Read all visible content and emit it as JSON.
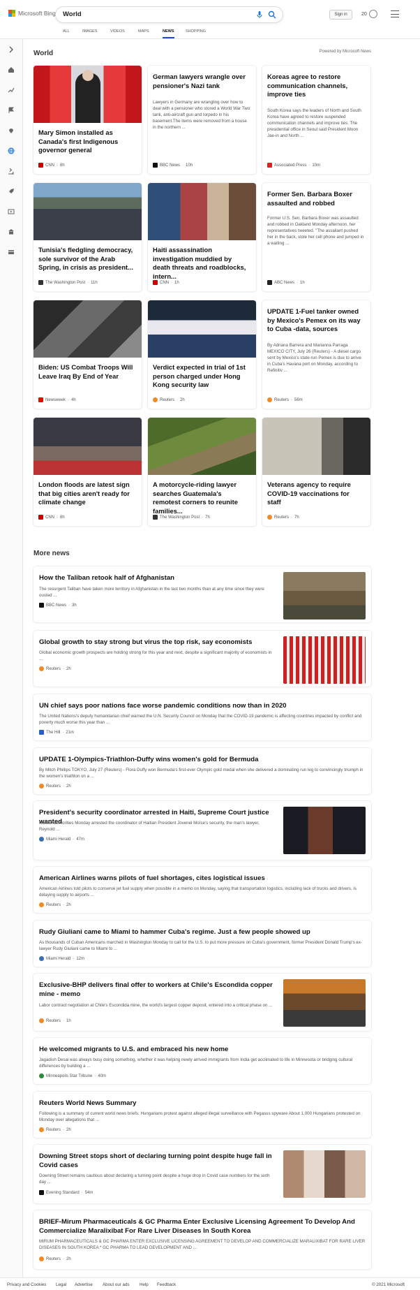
{
  "header": {
    "logo_text": "Microsoft Bing",
    "search_query": "World",
    "sign_in": "Sign in",
    "rewards": "20"
  },
  "tabs": [
    "ALL",
    "IMAGES",
    "VIDEOS",
    "MAPS",
    "NEWS",
    "SHOPPING"
  ],
  "section": {
    "title": "World",
    "powered": "Powered by Microsoft News"
  },
  "cards": [
    {
      "title": "Mary Simon installed as Canada's first Indigenous governor general",
      "snippet": "",
      "source": "CNN",
      "time": "8h",
      "src_color": "#c00"
    },
    {
      "title": "German lawyers wrangle over pensioner's Nazi tank",
      "snippet": "Lawyers in Germany are wrangling over how to deal with a pensioner who stored a World War Two tank, anti-aircraft gun and torpedo in his basement.The items were removed from a house in the northern ...",
      "source": "BBC News",
      "time": "10h",
      "src_color": "#111"
    },
    {
      "title": "Koreas agree to restore communication channels, improve ties",
      "snippet": "South Korea says the leaders of North and South Korea have agreed to restore suspended communication channels and improve ties. The presidential office in Seoul said President Moon Jae-in and North ...",
      "source": "Associated Press",
      "time": "10m",
      "src_color": "#d22"
    },
    {
      "title": "Tunisia's fledgling democracy, sole survivor of the Arab Spring, in crisis as president...",
      "snippet": "",
      "source": "The Washington Post",
      "time": "11h",
      "src_color": "#333"
    },
    {
      "title": "Haiti assassination investigation muddied by death threats and roadblocks, intern...",
      "snippet": "",
      "source": "CNN",
      "time": "1h",
      "src_color": "#c00"
    },
    {
      "title": "Former Sen. Barbara Boxer assaulted and robbed",
      "snippet": "Former U.S. Sen. Barbara Boxer was assaulted and robbed in Oakland Monday afternoon, her representatives tweeted. \"The assailant pushed her in the back, stole her cell phone and jumped in a waiting ...",
      "source": "ABC News",
      "time": "1h",
      "src_color": "#222"
    },
    {
      "title": "Biden: US Combat Troops Will Leave Iraq By End of Year",
      "snippet": "",
      "source": "Newsweek",
      "time": "4h",
      "src_color": "#d10"
    },
    {
      "title": "Verdict expected in trial of 1st person charged under Hong Kong security law",
      "snippet": "",
      "source": "Reuters",
      "time": "2h",
      "src_color": "#f08a24"
    },
    {
      "title": "UPDATE 1-Fuel tanker owned by Mexico's Pemex on its way to Cuba -data, sources",
      "snippet": "By Adriana Barrera and Marianna Parraga MEXICO CITY, July 26 (Reuters) - A diesel cargo sent by Mexico's state-run Pemex is due to arrive in Cuba's Havana port on Monday, according to Refinitiv ...",
      "source": "Reuters",
      "time": "56m",
      "src_color": "#f08a24"
    },
    {
      "title": "London floods are latest sign that big cities aren't ready for climate change",
      "snippet": "",
      "source": "CNN",
      "time": "8h",
      "src_color": "#c00"
    },
    {
      "title": "A motorcycle-riding lawyer searches Guatemala's remotest corners to reunite families...",
      "snippet": "",
      "source": "The Washington Post",
      "time": "7h",
      "src_color": "#333"
    },
    {
      "title": "Veterans agency to require COVID-19 vaccinations for staff",
      "snippet": "",
      "source": "Reuters",
      "time": "7h",
      "src_color": "#f08a24"
    }
  ],
  "more_title": "More news",
  "more": [
    {
      "title": "How the Taliban retook half of Afghanistan",
      "snippet": "The resurgent Taliban have taken more territory in Afghanistan in the last two months than at any time since they were ousted ...",
      "source": "BBC News",
      "time": "3h",
      "src_color": "#111"
    },
    {
      "title": "Global growth to stay strong but virus the top risk, say economists",
      "snippet": "Global economic growth prospects are holding strong for this year and next, despite a significant majority of economists in ...",
      "source": "Reuters",
      "time": "2h",
      "src_color": "#f08a24"
    },
    {
      "title": "UN chief says poor nations face worse pandemic conditions now than in 2020",
      "snippet": "The United Nations's deputy humanitarian chief warned the U.N. Security Council on Monday that the COVID-19 pandemic is affecting countries impacted by conflict and poverty much worse this year than ...",
      "source": "The Hill",
      "time": "21m",
      "src_color": "#2a5bd7"
    },
    {
      "title": "UPDATE 1-Olympics-Triathlon-Duffy wins women's gold for Bermuda",
      "snippet": "By Mitch Phillips TOKYO, July 27 (Reuters) - Flora Duffy won Bermuda's first-ever Olympic gold medal when she delivered a dominating run leg to convincingly triumph in the women's triathlon on a ...",
      "source": "Reuters",
      "time": "2h",
      "src_color": "#f08a24"
    },
    {
      "title": "President's security coordinator arrested in Haiti, Supreme Court justice wanted",
      "snippet": "Haitian authorities Monday arrested the coordinator of Haitian President Jovenel Moïse's security, the man's lawyer, Reynold ...",
      "source": "Miami Herald",
      "time": "47m",
      "src_color": "#3a6fb0"
    },
    {
      "title": "American Airlines warns pilots of fuel shortages, cites logistical issues",
      "snippet": "American Airlines told pilots to conserve jet fuel supply when possible in a memo on Monday, saying that transportation logistics, including lack of trucks and drivers, is delaying supply to airports ...",
      "source": "Reuters",
      "time": "2h",
      "src_color": "#f08a24"
    },
    {
      "title": "Rudy Giuliani came to Miami to hammer Cuba's regime. Just a few people showed up",
      "snippet": "As thousands of Cuban Americans marched in Washington Monday to call for the U.S. to put more pressure on Cuba's government, former President Donald Trump's ex-lawyer Rudy Giuliani came to Miami to ...",
      "source": "Miami Herald",
      "time": "12m",
      "src_color": "#3a6fb0"
    },
    {
      "title": "Exclusive-BHP delivers final offer to workers at Chile's Escondida copper mine - memo",
      "snippet": "Labor contract negotiation at Chile's Escondida mine, the world's largest copper deposit, entered into a critical phase on ...",
      "source": "Reuters",
      "time": "1h",
      "src_color": "#f08a24"
    },
    {
      "title": "He welcomed migrants to U.S. and embraced his new home",
      "snippet": "Jagadish Desai was always busy doing something, whether it was helping newly arrived immigrants from India get acclimated to life in Minnesota or bridging cultural differences by building a ...",
      "source": "Minneapolis Star Tribune",
      "time": "40m",
      "src_color": "#2a8a3a"
    },
    {
      "title": "Reuters World News Summary",
      "snippet": "Following is a summary of current world news briefs. Hungarians protest against alleged illegal surveillance with Pegasus spyware About 1,000 Hungarians protested on Monday over allegations that ...",
      "source": "Reuters",
      "time": "2h",
      "src_color": "#f08a24"
    },
    {
      "title": "Downing Street stops short of declaring turning point despite huge fall in Covid cases",
      "snippet": "Downing Street remains cautious about declaring a turning point despite a huge drop in Covid case numbers for the sixth day ...",
      "source": "Evening Standard",
      "time": "54m",
      "src_color": "#111"
    },
    {
      "title": "BRIEF-Mirum Pharmaceuticals & GC Pharma Enter Exclusive Licensing Agreement To Develop And Commercialize Maralixibat For Rare Liver Diseases In South Korea",
      "snippet": "MIRUM PHARMACEUTICALS & GC PHARMA ENTER EXCLUSIVE LICENSING AGREEMENT TO DEVELOP AND COMMERCIALIZE MARALIXIBAT FOR RARE LIVER DISEASES IN SOUTH KOREA * GC PHARMA TO LEAD DEVELOPMENT AND ...",
      "source": "Reuters",
      "time": "2h",
      "src_color": "#f08a24"
    }
  ],
  "footer": {
    "links": [
      "Privacy and Cookies",
      "Legal",
      "Advertise",
      "About our ads",
      "Help",
      "Feedback"
    ],
    "copyright": "© 2021 Microsoft"
  }
}
